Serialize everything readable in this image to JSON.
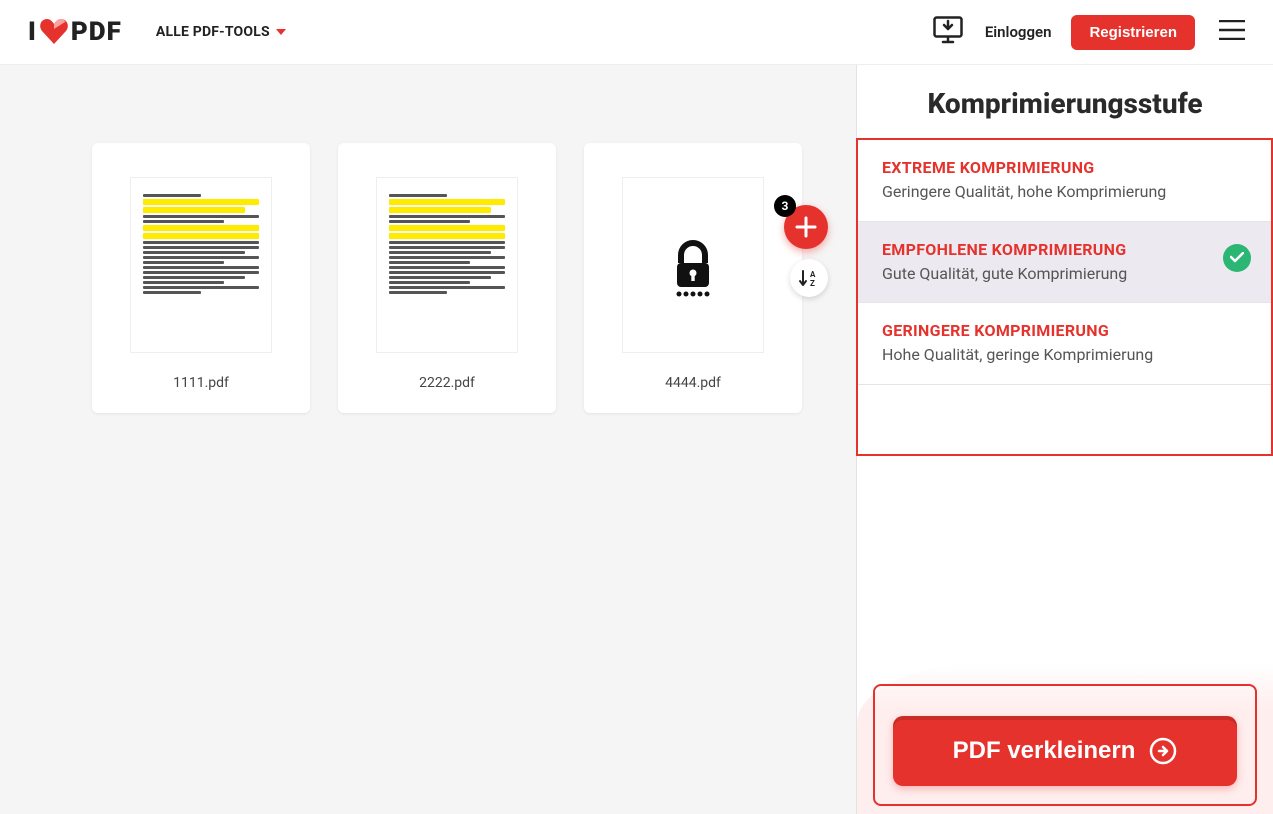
{
  "brand": {
    "i": "I",
    "pdf": "PDF"
  },
  "nav": {
    "all_tools": "ALLE PDF-TOOLS"
  },
  "header": {
    "login": "Einloggen",
    "register": "Registrieren"
  },
  "files_count": "3",
  "files": [
    {
      "name": "1111.pdf",
      "locked": false
    },
    {
      "name": "2222.pdf",
      "locked": false
    },
    {
      "name": "4444.pdf",
      "locked": true
    }
  ],
  "sidebar": {
    "title": "Komprimierungsstufe",
    "options": [
      {
        "title": "EXTREME KOMPRIMIERUNG",
        "desc": "Geringere Qualität, hohe Komprimierung",
        "selected": false
      },
      {
        "title": "EMPFOHLENE KOMPRIMIERUNG",
        "desc": "Gute Qualität, gute Komprimierung",
        "selected": true
      },
      {
        "title": "GERINGERE KOMPRIMIERUNG",
        "desc": "Hohe Qualität, geringe Komprimierung",
        "selected": false
      }
    ],
    "action": "PDF verkleinern"
  },
  "colors": {
    "accent": "#e5322d",
    "success": "#2bb673"
  }
}
